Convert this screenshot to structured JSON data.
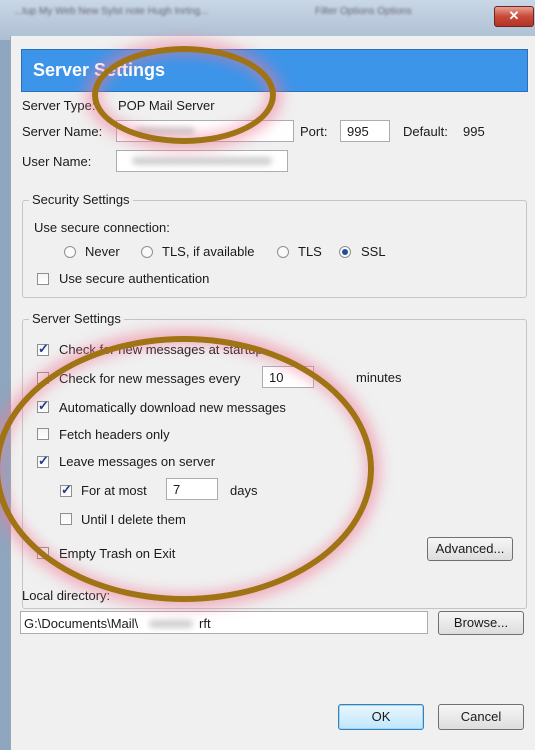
{
  "background": {
    "left_text": "...tup My Web New Sylst note Hugh Inrtng...",
    "right_text": "Filter Options Options"
  },
  "window": {
    "close_symbol": "✕"
  },
  "header": {
    "title": "Server Settings"
  },
  "server": {
    "type_label": "Server Type:",
    "type_value": "POP Mail Server",
    "name_label": "Server Name:",
    "port_label": "Port:",
    "port_value": "995",
    "default_label": "Default:",
    "default_value": "995",
    "username_label": "User Name:"
  },
  "security": {
    "legend": "Security Settings",
    "connection_label": "Use secure connection:",
    "options": [
      "Never",
      "TLS, if available",
      "TLS",
      "SSL"
    ],
    "selected": "SSL",
    "secure_auth_label": "Use secure authentication",
    "secure_auth_checked": false
  },
  "server_settings": {
    "legend": "Server Settings",
    "check_startup_label": "Check for new messages at startup",
    "check_every_label": "Check for new messages every",
    "check_every_value": "10",
    "minutes_label": "minutes",
    "auto_download_label": "Automatically download new messages",
    "fetch_headers_label": "Fetch headers only",
    "leave_on_server_label": "Leave messages on server",
    "for_at_most_label": "For at most",
    "for_at_most_value": "7",
    "days_label": "days",
    "until_delete_label": "Until I delete them",
    "empty_trash_label": "Empty Trash on Exit",
    "advanced_button": "Advanced..."
  },
  "local": {
    "label": "Local directory:",
    "path_start": "G:\\Documents\\Mail\\",
    "path_end": "rft",
    "browse_button": "Browse..."
  },
  "footer": {
    "ok": "OK",
    "cancel": "Cancel"
  },
  "colors": {
    "header": "#3d95ea",
    "annotation_ring": "#a07414",
    "annotation_glow": "#f07896"
  }
}
